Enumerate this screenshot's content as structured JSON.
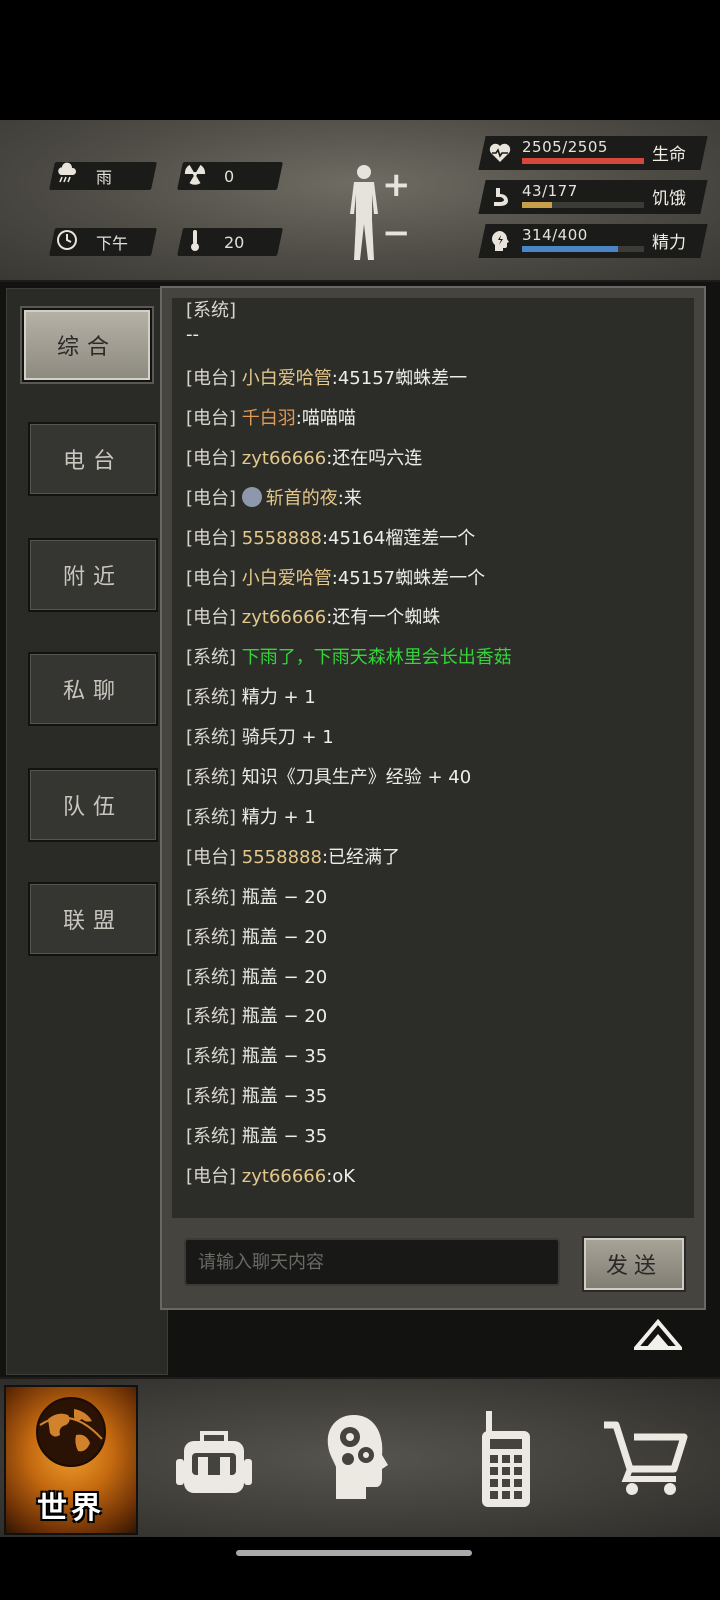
{
  "status": {
    "weather": "雨",
    "radiation": "0",
    "time_of_day": "下午",
    "temperature": "20"
  },
  "vitals": [
    {
      "value": "2505/2505",
      "label": "生命",
      "fraction": 1.0,
      "color": "#d6473b",
      "icon": "heart-pulse-icon"
    },
    {
      "value": "43/177",
      "label": "饥饿",
      "fraction": 0.243,
      "color": "#c9a04a",
      "icon": "stomach-icon"
    },
    {
      "value": "314/400",
      "label": "精力",
      "fraction": 0.785,
      "color": "#4a86c6",
      "icon": "energy-head-icon"
    }
  ],
  "tabs": [
    "综合",
    "电台",
    "附近",
    "私聊",
    "队伍",
    "联盟"
  ],
  "active_tab": "综合",
  "chat": {
    "truncated_top_tag": "[系统]",
    "truncated_top_text": "--",
    "messages": [
      {
        "tag": "[电台]",
        "speaker": "小白爱哈管",
        "text": ":45157蜘蛛差一"
      },
      {
        "tag": "[电台]",
        "speaker": "千白羽",
        "text": ":喵喵喵",
        "speaker_color": "orange"
      },
      {
        "tag": "[电台]",
        "speaker": "zyt66666",
        "text": ":还在吗六连"
      },
      {
        "tag": "[电台]",
        "speaker": "斩首的夜",
        "text": ":来",
        "avatar": true
      },
      {
        "tag": "[电台]",
        "speaker": "5558888",
        "text": ":45164榴莲差一个"
      },
      {
        "tag": "[电台]",
        "speaker": "小白爱哈管",
        "text": ":45157蜘蛛差一个"
      },
      {
        "tag": "[电台]",
        "speaker": "zyt66666",
        "text": ":还有一个蜘蛛"
      },
      {
        "tag": "[系统]",
        "speaker": "",
        "text": "下雨了，下雨天森林里会长出香菇",
        "green": true
      },
      {
        "tag": "[系统]",
        "speaker": "",
        "text": "精力 + 1"
      },
      {
        "tag": "[系统]",
        "speaker": "",
        "text": "骑兵刀 + 1"
      },
      {
        "tag": "[系统]",
        "speaker": "",
        "text": "知识《刀具生产》经验 + 40"
      },
      {
        "tag": "[系统]",
        "speaker": "",
        "text": "精力 + 1"
      },
      {
        "tag": "[电台]",
        "speaker": "5558888",
        "text": ":已经满了"
      },
      {
        "tag": "[系统]",
        "speaker": "",
        "text": "瓶盖 − 20"
      },
      {
        "tag": "[系统]",
        "speaker": "",
        "text": "瓶盖 − 20"
      },
      {
        "tag": "[系统]",
        "speaker": "",
        "text": "瓶盖 − 20"
      },
      {
        "tag": "[系统]",
        "speaker": "",
        "text": "瓶盖 − 20"
      },
      {
        "tag": "[系统]",
        "speaker": "",
        "text": "瓶盖 − 35"
      },
      {
        "tag": "[系统]",
        "speaker": "",
        "text": "瓶盖 − 35"
      },
      {
        "tag": "[系统]",
        "speaker": "",
        "text": "瓶盖 − 35"
      },
      {
        "tag": "[电台]",
        "speaker": "zyt66666",
        "text": ":oK"
      }
    ],
    "input_placeholder": "请输入聊天内容",
    "send_label": "发送"
  },
  "bottom_nav": {
    "world_label": "世界",
    "items": [
      "globe-icon",
      "backpack-icon",
      "brain-gears-icon",
      "radio-icon",
      "shopping-cart-icon"
    ]
  }
}
